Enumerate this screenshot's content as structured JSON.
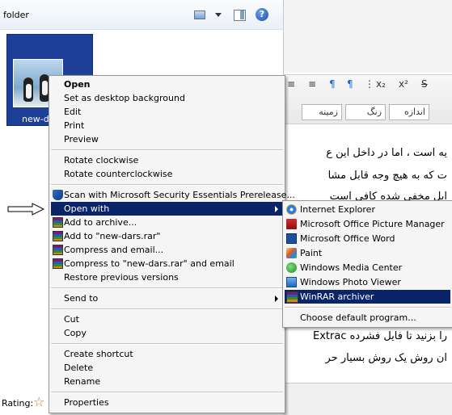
{
  "explorer": {
    "folder_label": "folder",
    "help_glyph": "?",
    "file_name": "new-dars",
    "rating_label": "Rating:",
    "rating_star": "☆"
  },
  "icons": {
    "views": "views-icon",
    "views_dropdown": "chevron-down-icon",
    "preview_pane": "preview-pane-icon",
    "help": "help-icon",
    "star": "star-icon",
    "shield": "shield-icon",
    "winrar": "winrar-icon"
  },
  "editor": {
    "toolbar_symbols": [
      "≡",
      "≡",
      "¶",
      "¶",
      "⋮",
      "x₂",
      "x²",
      "S"
    ],
    "combos": [
      "اندازه",
      "رنگ",
      "زمینه"
    ],
    "lines": [
      "یه است ، اما در داخل این ع",
      "ت که به هیچ وجه قابل مشا",
      "ایل مخفی شده کافی است",
      "را بزنید تا فایل فشرده Extrac",
      "ان روش یک روش بسیار حر"
    ]
  },
  "context_menu": {
    "items": [
      {
        "label": "Open",
        "bold": true
      },
      {
        "label": "Set as desktop background"
      },
      {
        "label": "Edit"
      },
      {
        "label": "Print"
      },
      {
        "label": "Preview"
      },
      {
        "label": "Rotate clockwise"
      },
      {
        "label": "Rotate counterclockwise"
      },
      {
        "label": "Scan with Microsoft Security Essentials Prerelease..."
      },
      {
        "label": "Open with"
      },
      {
        "label": "Add to archive..."
      },
      {
        "label": "Add to \"new-dars.rar\""
      },
      {
        "label": "Compress and email..."
      },
      {
        "label": "Compress to \"new-dars.rar\" and email"
      },
      {
        "label": "Restore previous versions"
      },
      {
        "label": "Send to"
      },
      {
        "label": "Cut"
      },
      {
        "label": "Copy"
      },
      {
        "label": "Create shortcut"
      },
      {
        "label": "Delete"
      },
      {
        "label": "Rename"
      },
      {
        "label": "Properties"
      }
    ]
  },
  "open_with_menu": {
    "items": [
      {
        "label": "Internet Explorer",
        "icon": "internet-explorer-icon"
      },
      {
        "label": "Microsoft Office Picture Manager",
        "icon": "picture-manager-icon"
      },
      {
        "label": "Microsoft Office Word",
        "icon": "word-icon"
      },
      {
        "label": "Paint",
        "icon": "paint-icon"
      },
      {
        "label": "Windows Media Center",
        "icon": "media-center-icon"
      },
      {
        "label": "Windows Photo Viewer",
        "icon": "photo-viewer-icon"
      },
      {
        "label": "WinRAR archiver",
        "icon": "winrar-icon"
      },
      {
        "label": "Choose default program..."
      }
    ]
  },
  "colors": {
    "highlight": "#0a246a",
    "menu_bg": "#f5f5f5",
    "thumbnail_selection": "#1e3f98"
  }
}
